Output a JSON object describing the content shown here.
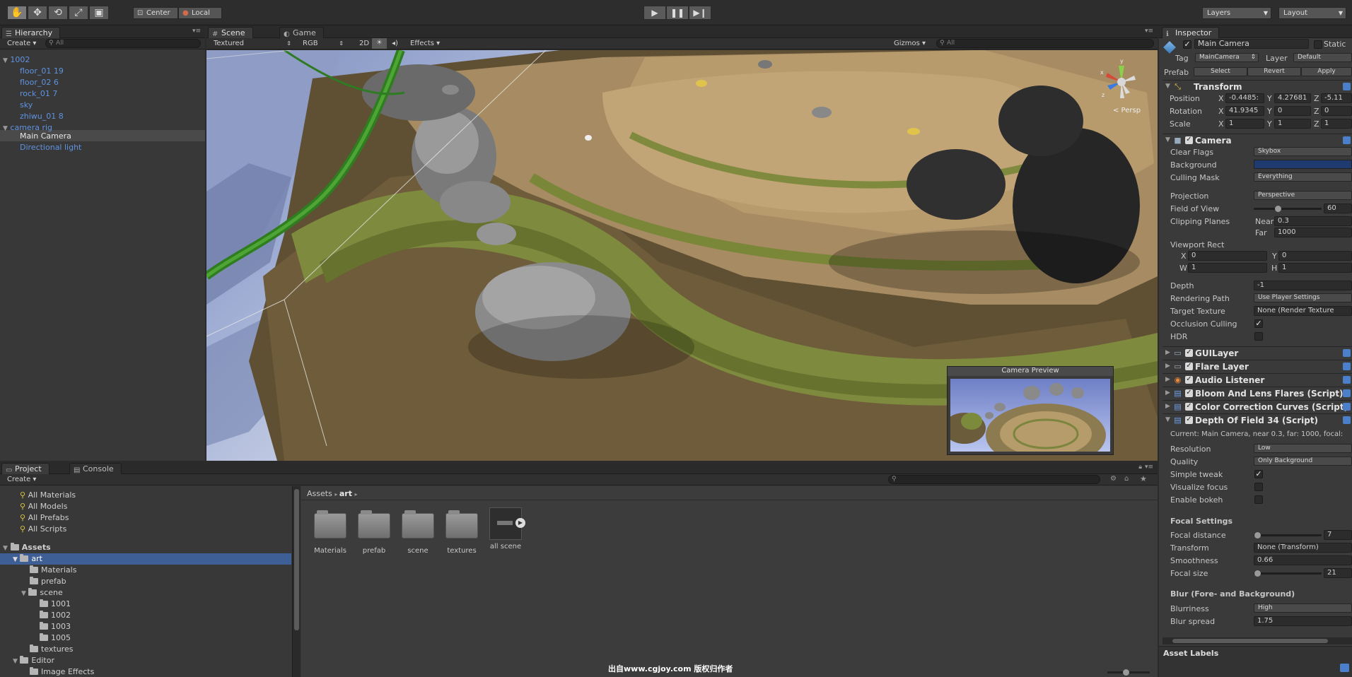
{
  "toolbar": {
    "tools": [
      "hand-tool",
      "move-tool",
      "rotate-tool",
      "scale-tool",
      "rect-tool"
    ],
    "pivot_label": "Center",
    "space_label": "Local",
    "layers_label": "Layers",
    "layout_label": "Layout"
  },
  "hierarchy": {
    "tab_label": "Hierarchy",
    "create_label": "Create",
    "search_placeholder": "All",
    "items": [
      {
        "label": "1002",
        "indent": 0,
        "expanded": true
      },
      {
        "label": "floor_01 19",
        "indent": 1
      },
      {
        "label": "floor_02 6",
        "indent": 1
      },
      {
        "label": "rock_01 7",
        "indent": 1
      },
      {
        "label": "sky",
        "indent": 1
      },
      {
        "label": "zhiwu_01 8",
        "indent": 1
      },
      {
        "label": "camera rig",
        "indent": 0,
        "expanded": true
      },
      {
        "label": "Main Camera",
        "indent": 1,
        "selected": true
      },
      {
        "label": "Directional light",
        "indent": 1
      }
    ]
  },
  "scene": {
    "tabs": [
      "Scene",
      "Game"
    ],
    "render_mode": "Textured",
    "color_mode": "RGB",
    "mode_2d": "2D",
    "effects_label": "Effects",
    "gizmos_label": "Gizmos",
    "search_placeholder": "All",
    "persp_label": "< Persp",
    "camera_preview_title": "Camera Preview"
  },
  "project": {
    "tabs": [
      "Project",
      "Console"
    ],
    "create_label": "Create",
    "favorites": [
      "All Materials",
      "All Models",
      "All Prefabs",
      "All Scripts"
    ],
    "tree": [
      {
        "label": "Assets",
        "indent": 0,
        "bold": true
      },
      {
        "label": "art",
        "indent": 1,
        "selected": true
      },
      {
        "label": "Materials",
        "indent": 2
      },
      {
        "label": "prefab",
        "indent": 2
      },
      {
        "label": "scene",
        "indent": 2
      },
      {
        "label": "1001",
        "indent": 3
      },
      {
        "label": "1002",
        "indent": 3
      },
      {
        "label": "1003",
        "indent": 3
      },
      {
        "label": "1005",
        "indent": 3
      },
      {
        "label": "textures",
        "indent": 2
      },
      {
        "label": "Editor",
        "indent": 1
      },
      {
        "label": "Image Effects",
        "indent": 2
      }
    ],
    "breadcrumb": [
      "Assets",
      "art"
    ],
    "assets": [
      "Materials",
      "prefab",
      "scene",
      "textures",
      "all scene"
    ]
  },
  "inspector": {
    "tab_label": "Inspector",
    "object_name": "Main Camera",
    "static_label": "Static",
    "tag_label": "Tag",
    "tag_value": "MainCamera",
    "layer_label": "Layer",
    "layer_value": "Default",
    "prefab_label": "Prefab",
    "prefab_buttons": [
      "Select",
      "Revert",
      "Apply"
    ],
    "transform": {
      "title": "Transform",
      "position_label": "Position",
      "rotation_label": "Rotation",
      "scale_label": "Scale",
      "position": {
        "x": "-0.4485:",
        "y": "4.27681",
        "z": "-5.11"
      },
      "rotation": {
        "x": "41.9345",
        "y": "0",
        "z": "0"
      },
      "scale": {
        "x": "1",
        "y": "1",
        "z": "1"
      }
    },
    "camera": {
      "title": "Camera",
      "clear_flags_label": "Clear Flags",
      "clear_flags": "Skybox",
      "background_label": "Background",
      "culling_mask_label": "Culling Mask",
      "culling_mask": "Everything",
      "projection_label": "Projection",
      "projection": "Perspective",
      "fov_label": "Field of View",
      "fov": "60",
      "fov_fraction": 0.35,
      "clipping_label": "Clipping Planes",
      "near_label": "Near",
      "near": "0.3",
      "far_label": "Far",
      "far": "1000",
      "viewport_label": "Viewport Rect",
      "vx_label": "X",
      "vx": "0",
      "vy_label": "Y",
      "vy": "0",
      "vw_label": "W",
      "vw": "1",
      "vh_label": "H",
      "vh": "1",
      "depth_label": "Depth",
      "depth": "-1",
      "rendering_path_label": "Rendering Path",
      "rendering_path": "Use Player Settings",
      "target_texture_label": "Target Texture",
      "target_texture": "None (Render Texture",
      "occlusion_label": "Occlusion Culling",
      "occlusion": true,
      "hdr_label": "HDR",
      "hdr": false
    },
    "components": [
      "GUILayer",
      "Flare Layer",
      "Audio Listener",
      "Bloom And Lens Flares (Script)",
      "Color Correction Curves (Script)"
    ],
    "dof": {
      "title": "Depth Of Field 34 (Script)",
      "info": "Current: Main Camera, near 0.3, far: 1000, focal:",
      "resolution_label": "Resolution",
      "resolution": "Low",
      "quality_label": "Quality",
      "quality": "Only Background",
      "simple_tweak_label": "Simple tweak",
      "simple_tweak": true,
      "visualize_focus_label": "Visualize focus",
      "visualize_focus": false,
      "enable_bokeh_label": "Enable bokeh",
      "enable_bokeh": false,
      "focal_settings_header": "Focal Settings",
      "focal_distance_label": "Focal distance",
      "focal_distance": "7",
      "focal_distance_fraction": 0.05,
      "transform_label": "Transform",
      "transform_value": "None (Transform)",
      "smoothness_label": "Smoothness",
      "smoothness": "0.66",
      "focal_size_label": "Focal size",
      "focal_size": "21",
      "focal_size_fraction": 0.05,
      "blur_header": "Blur (Fore- and Background)",
      "blurriness_label": "Blurriness",
      "blurriness": "High",
      "blur_spread_label": "Blur spread",
      "blur_spread": "1.75"
    },
    "asset_labels": "Asset Labels"
  },
  "watermark": "出自www.cgjoy.com 版权归作者"
}
